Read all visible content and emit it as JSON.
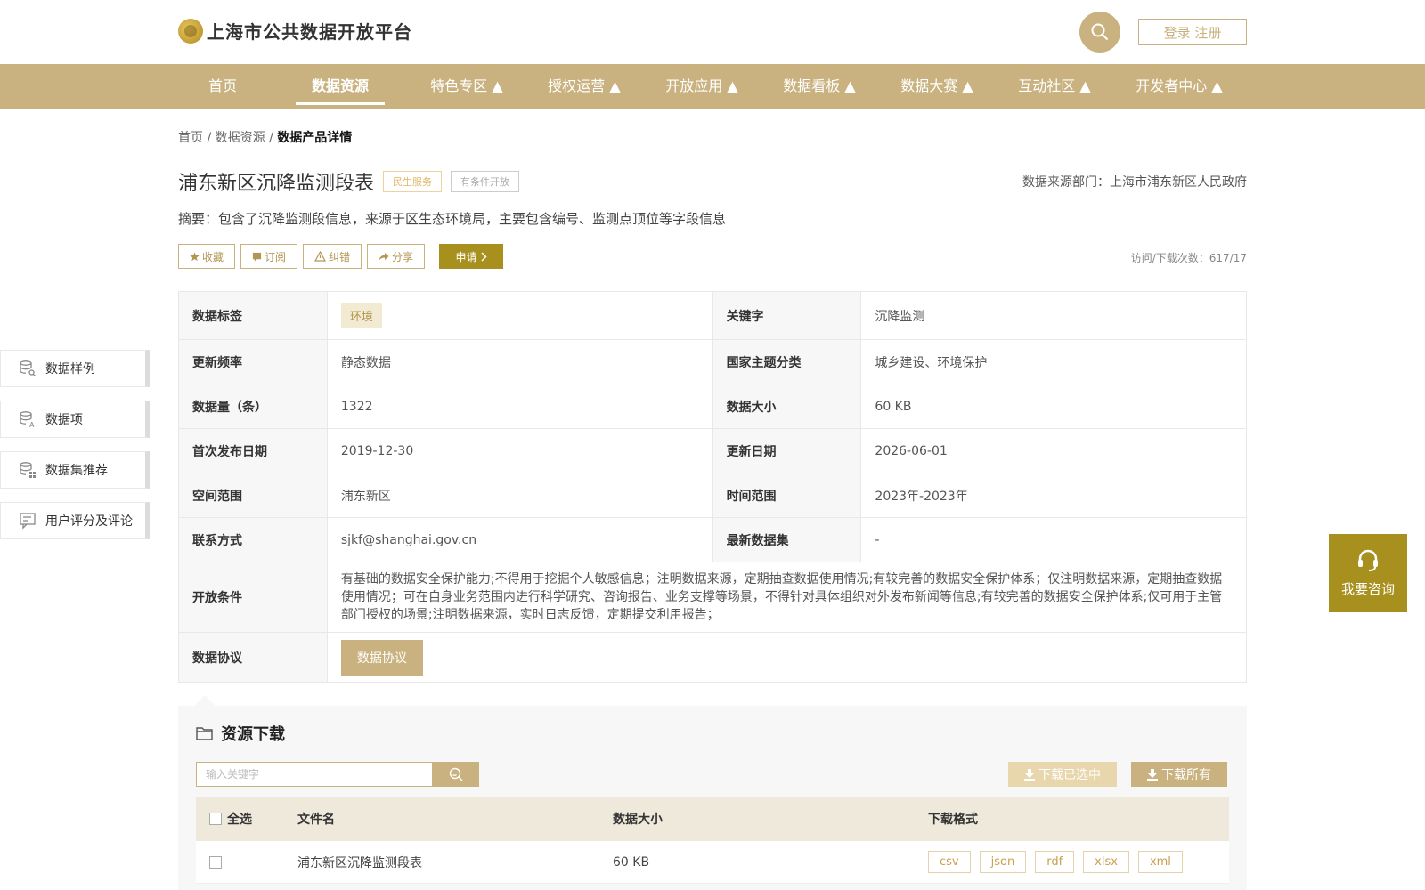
{
  "header": {
    "site_title": "上海市公共数据开放平台",
    "login_label": "登录 注册"
  },
  "nav": {
    "items": [
      {
        "label": "首页"
      },
      {
        "label": "数据资源"
      },
      {
        "label": "特色专区 ▲"
      },
      {
        "label": "授权运营 ▲"
      },
      {
        "label": "开放应用 ▲"
      },
      {
        "label": "数据看板 ▲"
      },
      {
        "label": "数据大赛 ▲"
      },
      {
        "label": "互动社区 ▲"
      },
      {
        "label": "开发者中心 ▲"
      }
    ],
    "active_index": 1
  },
  "breadcrumb": {
    "home": "首页",
    "sep": " / ",
    "section": "数据资源",
    "current": "数据产品详情"
  },
  "dataset": {
    "title": "浦东新区沉降监测段表",
    "tag_category": "民生服务",
    "tag_access": "有条件开放",
    "source": "数据来源部门：上海市浦东新区人民政府",
    "summary": "摘要：包含了沉降监测段信息，来源于区生态环境局，主要包含编号、监测点顶位等字段信息",
    "visits": "访问/下载次数：617/17"
  },
  "actions": {
    "favorite": "收藏",
    "subscribe": "订阅",
    "report": "纠错",
    "share": "分享",
    "apply": "申请"
  },
  "info": {
    "tag_label": "数据标签",
    "tag_value": "环境",
    "keyword_label": "关键字",
    "keyword_value": "沉降监测",
    "freq_label": "更新频率",
    "freq_value": "静态数据",
    "theme_label": "国家主题分类",
    "theme_value": "城乡建设、环境保护",
    "count_label": "数据量（条）",
    "count_value": "1322",
    "size_label": "数据大小",
    "size_value": "60 KB",
    "first_label": "首次发布日期",
    "first_value": "2019-12-30",
    "updated_label": "更新日期",
    "updated_value": "2026-06-01",
    "space_label": "空间范围",
    "space_value": "浦东新区",
    "time_label": "时间范围",
    "time_value": "2023年-2023年",
    "contact_label": "联系方式",
    "contact_value": "sjkf@shanghai.gov.cn",
    "latest_label": "最新数据集",
    "latest_value": "-",
    "open_label": "开放条件",
    "open_value": "有基础的数据安全保护能力;不得用于挖掘个人敏感信息；注明数据来源，定期抽查数据使用情况;有较完善的数据安全保护体系；仅注明数据来源，定期抽查数据使用情况；可在自身业务范围内进行科学研究、咨询报告、业务支撑等场景，不得针对具体组织对外发布新闻等信息;有较完善的数据安全保护体系;仅可用于主管部门授权的场景;注明数据来源，实时日志反馈，定期提交利用报告；",
    "agreement_label": "数据协议",
    "agreement_button": "数据协议"
  },
  "side_menu": {
    "items": [
      {
        "label": "数据样例",
        "icon": "database-search-icon"
      },
      {
        "label": "数据项",
        "icon": "database-text-icon"
      },
      {
        "label": "数据集推荐",
        "icon": "database-grid-icon"
      },
      {
        "label": "用户评分及评论",
        "icon": "comment-icon"
      }
    ]
  },
  "consult": {
    "label": "我要咨询"
  },
  "download": {
    "title": "资源下载",
    "search_placeholder": "输入关键字",
    "download_selected": "下载已选中",
    "download_all": "下载所有",
    "columns": {
      "select_all": "全选",
      "filename": "文件名",
      "size": "数据大小",
      "format": "下载格式"
    },
    "rows": [
      {
        "filename": "浦东新区沉降监测段表",
        "size": "60 KB",
        "formats": [
          "csv",
          "json",
          "rdf",
          "xlsx",
          "xml"
        ]
      }
    ]
  },
  "colors": {
    "brand": "#c9b27f",
    "accent_dark": "#a8901f"
  }
}
